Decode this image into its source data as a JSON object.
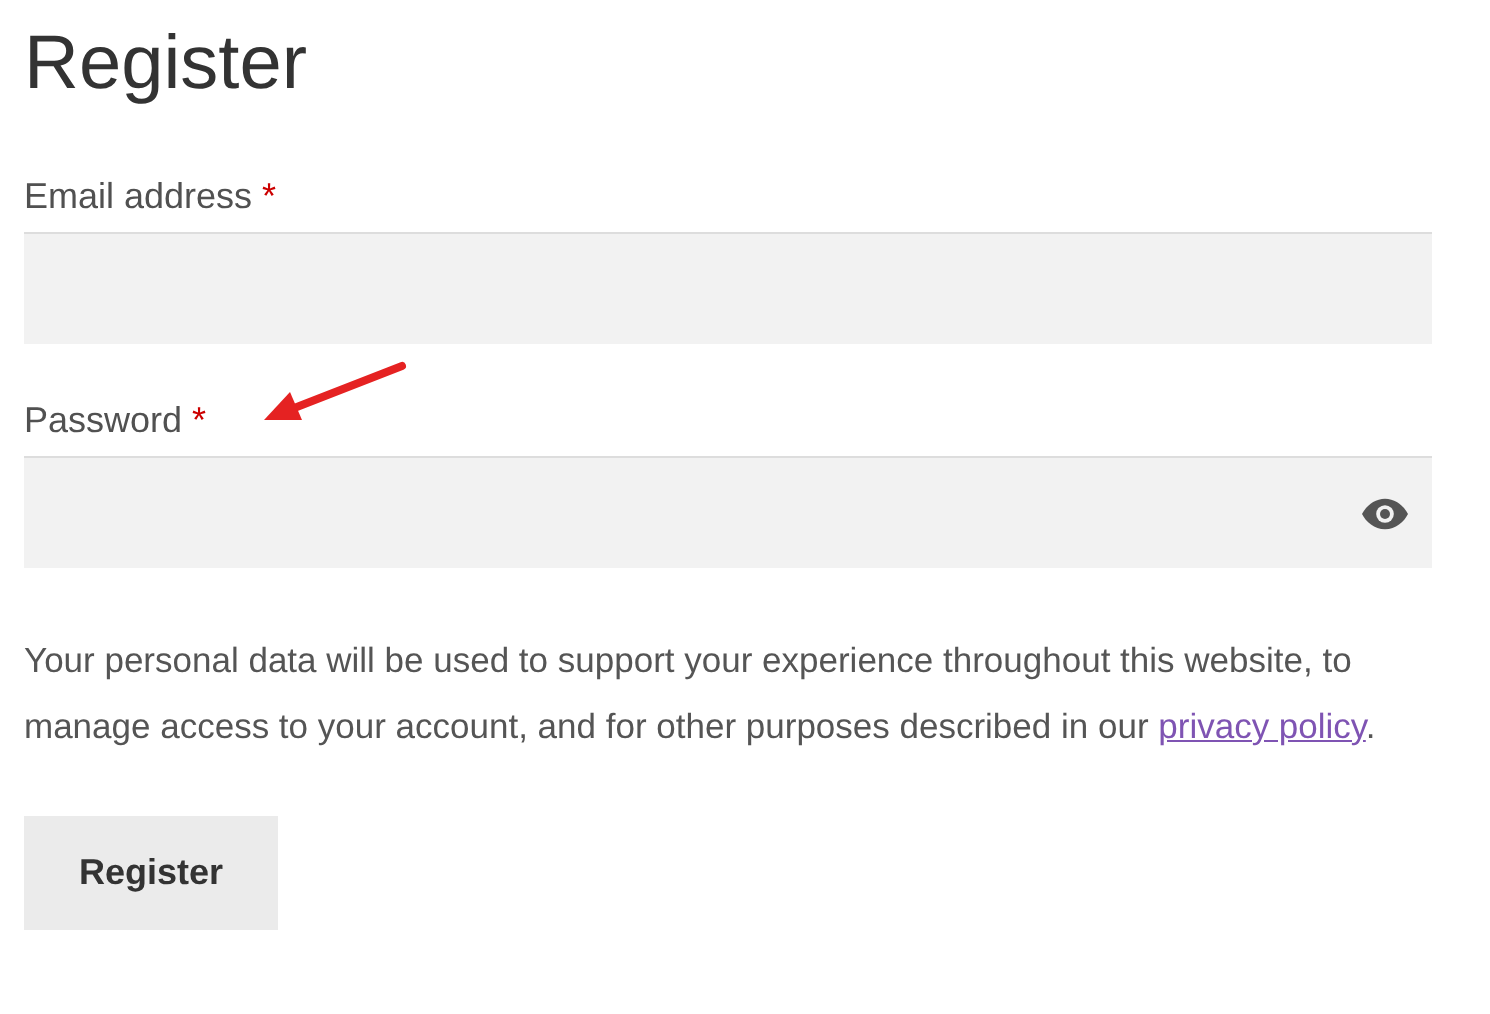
{
  "title": "Register",
  "fields": [
    {
      "label": "Email address",
      "required_mark": "*",
      "kind": "email"
    },
    {
      "label": "Password",
      "required_mark": "*",
      "kind": "password"
    }
  ],
  "privacy": {
    "text_before": "Your personal data will be used to support your experience throughout this website, to manage access to your account, and for other purposes described in our ",
    "link": "privacy policy",
    "text_after": "."
  },
  "button": "Register"
}
